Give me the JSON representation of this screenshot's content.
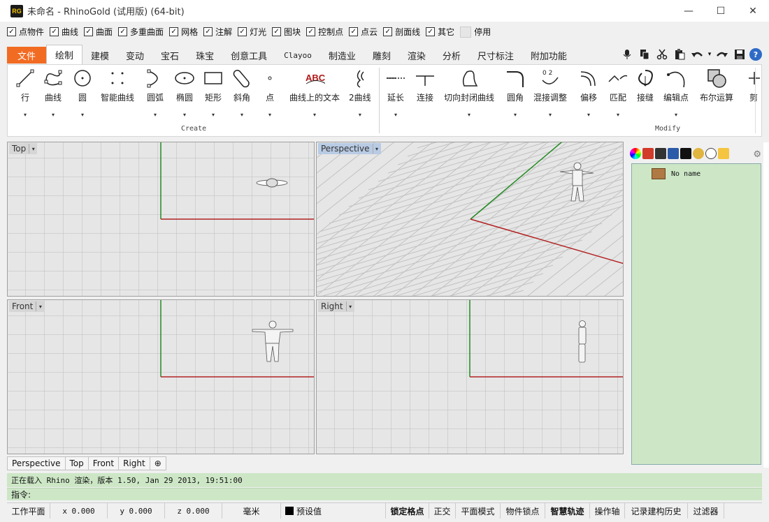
{
  "window": {
    "app_icon": "RG",
    "title": "未命名 - RhinoGold (试用版) (64-bit)",
    "minimize_icon": "—",
    "maximize_icon": "☐",
    "close_icon": "✕"
  },
  "filters": {
    "items": [
      {
        "label": "点物件",
        "checked": true
      },
      {
        "label": "曲线",
        "checked": true
      },
      {
        "label": "曲面",
        "checked": true
      },
      {
        "label": "多重曲面",
        "checked": true
      },
      {
        "label": "网格",
        "checked": true
      },
      {
        "label": "注解",
        "checked": true
      },
      {
        "label": "灯光",
        "checked": true
      },
      {
        "label": "图块",
        "checked": true
      },
      {
        "label": "控制点",
        "checked": true
      },
      {
        "label": "点云",
        "checked": true
      },
      {
        "label": "剖面线",
        "checked": true
      },
      {
        "label": "其它",
        "checked": true
      }
    ],
    "disable_label": "停用",
    "check_glyph": "✓"
  },
  "tabs": {
    "file": "文件",
    "items": [
      "绘制",
      "建模",
      "变动",
      "宝石",
      "珠宝",
      "创意工具",
      "Clayoo",
      "制造业",
      "雕刻",
      "渲染",
      "分析",
      "尺寸标注",
      "附加功能"
    ],
    "active": "绘制",
    "help_glyph": "?",
    "qat_icons": [
      "microphone-icon",
      "copy-icon",
      "cut-icon",
      "paste-icon",
      "undo-icon",
      "redo-icon",
      "save-icon"
    ]
  },
  "ribbon": {
    "create_buttons": [
      "行",
      "曲线",
      "圆",
      "智能曲线",
      "圆弧",
      "椭圆",
      "矩形",
      "斜角",
      "点",
      "曲线上的文本",
      "2曲线"
    ],
    "modify_buttons": [
      "延长",
      "连接",
      "切向封闭曲线",
      "圆角",
      "混接调整",
      "偏移",
      "匹配",
      "接缝",
      "编辑点",
      "布尔运算",
      "剪"
    ],
    "create_group": "Create",
    "modify_group": "Modify",
    "text_icon_label": "ABC",
    "blend_icon_label": "0 2",
    "dropdown_glyph": "▾"
  },
  "viewports": {
    "top": "Top",
    "perspective": "Perspective",
    "front": "Front",
    "right": "Right",
    "menu_glyph": "▾"
  },
  "view_tabs": [
    "Perspective",
    "Top",
    "Front",
    "Right"
  ],
  "view_tab_add": "⊕",
  "layers": {
    "items": [
      "No name"
    ]
  },
  "command": {
    "history": "正在载入 Rhino 渲染，版本 1.50, Jan 29 2013, 19:51:00",
    "prompt": "指令:"
  },
  "status": {
    "cplane": "工作平面",
    "x": "x 0.000",
    "y": "y 0.000",
    "z": "z 0.000",
    "units": "毫米",
    "layer": "预设值",
    "grid_snap": "锁定格点",
    "ortho": "正交",
    "planar": "平面模式",
    "osnap": "物件锁点",
    "smarttrack": "智慧轨迹",
    "gumball": "操作轴",
    "history": "记录建构历史",
    "filter": "过滤器"
  },
  "colors": {
    "accent_file": "#f26b22",
    "command_bg": "#cde7c6",
    "axis_x": "#b22222",
    "axis_y": "#228b22"
  }
}
